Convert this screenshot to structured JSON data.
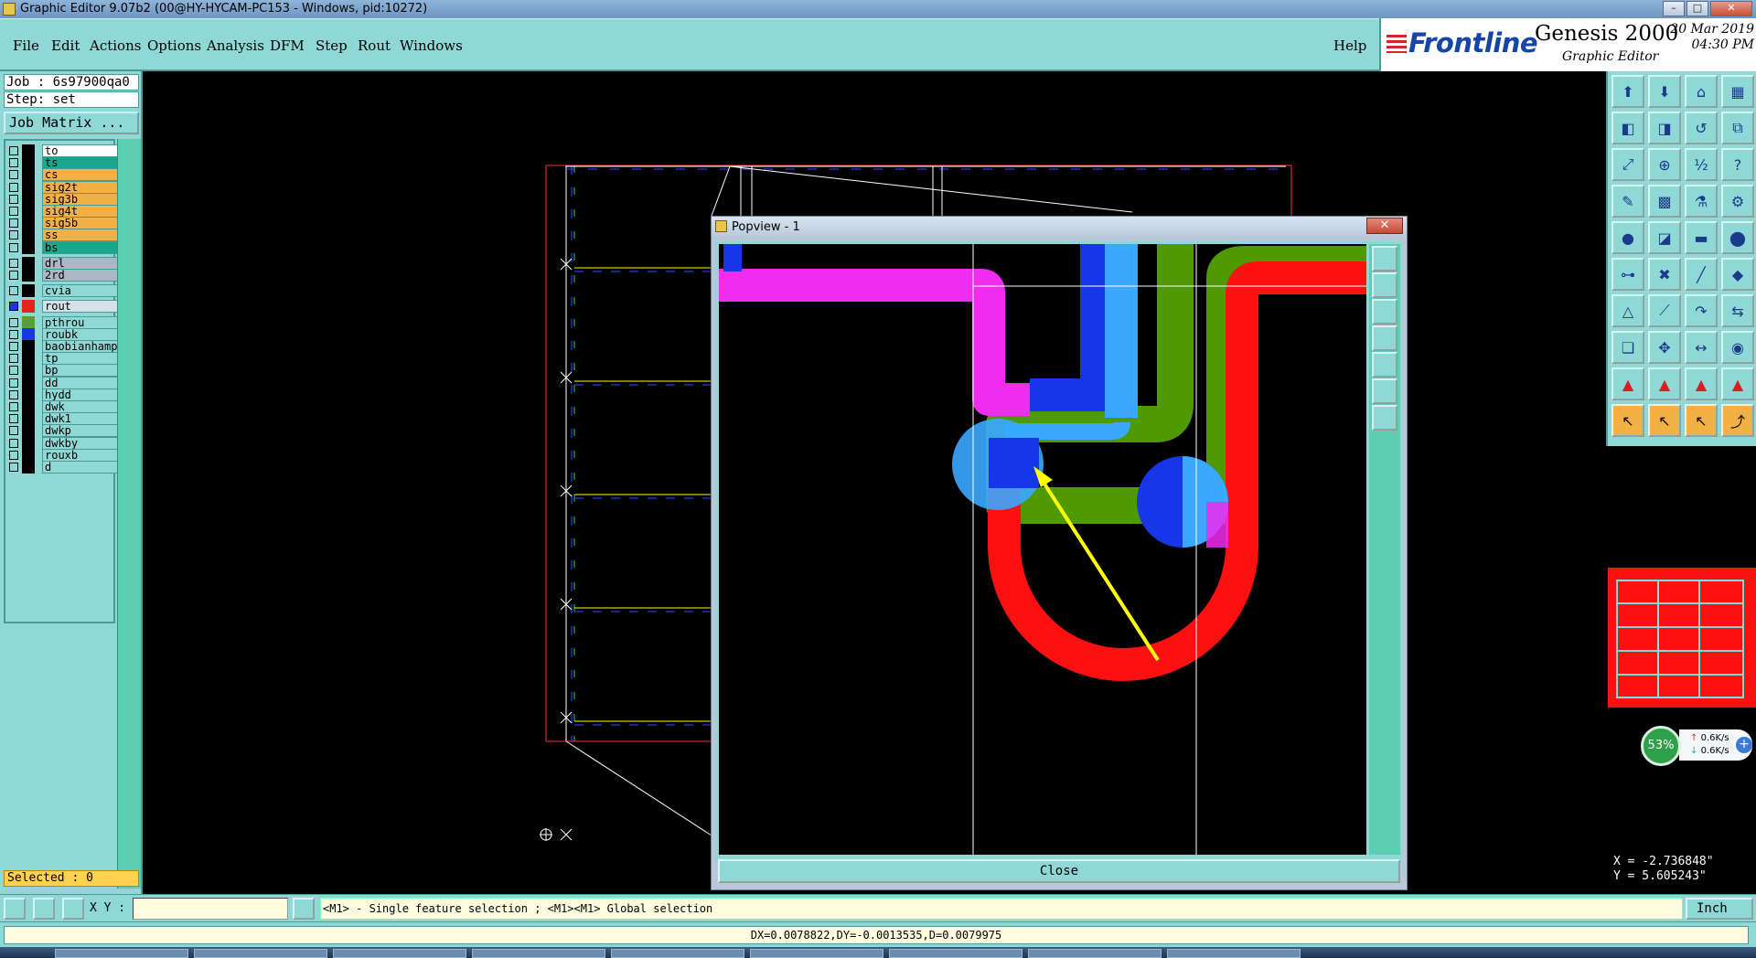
{
  "window": {
    "title": "Graphic Editor 9.07b2 (00@HY-HYCAM-PC153 - Windows, pid:10272)",
    "controls": [
      "–",
      "□",
      "✕"
    ]
  },
  "menu": [
    "File",
    "Edit",
    "Actions",
    "Options",
    "Analysis",
    "DFM",
    "Step",
    "Rout",
    "Windows"
  ],
  "menu_help": "Help",
  "brand": {
    "logo": "Frontline",
    "product": "Genesis 2000",
    "subtitle": "Graphic Editor",
    "date": "20 Mar 2019",
    "time": "04:30 PM"
  },
  "job": {
    "job_label": "Job : 6s97900qa0",
    "step_label": "Step: set",
    "matrix_button": "Job Matrix ..."
  },
  "layers": [
    {
      "name": "to",
      "color": "#ffffff",
      "swatch": "#000000"
    },
    {
      "name": "ts",
      "color": "#17a88c",
      "swatch": "#000000"
    },
    {
      "name": "cs",
      "color": "#f3b046",
      "swatch": "#000000"
    },
    {
      "name": "sig2t",
      "color": "#f3b046",
      "swatch": "#000000"
    },
    {
      "name": "sig3b",
      "color": "#f3b046",
      "swatch": "#000000"
    },
    {
      "name": "sig4t",
      "color": "#f3b046",
      "swatch": "#000000"
    },
    {
      "name": "sig5b",
      "color": "#f3b046",
      "swatch": "#000000"
    },
    {
      "name": "ss",
      "color": "#f3b046",
      "swatch": "#000000"
    },
    {
      "name": "bs",
      "color": "#17a88c",
      "swatch": "#000000"
    },
    {
      "name": "drl",
      "color": "#a9b8c4",
      "swatch": "#000000",
      "gap": true
    },
    {
      "name": "2rd",
      "color": "#a9b8c4",
      "swatch": "#000000"
    },
    {
      "name": "cvia",
      "color": "#8fd8d6",
      "swatch": "#000000",
      "gap": true
    },
    {
      "name": "rout",
      "color": "#d8e0e8",
      "swatch": "#e8201e",
      "gap": true,
      "active": true
    },
    {
      "name": "pthrou",
      "color": "#8fd8d6",
      "swatch": "#5aa02a",
      "gap": true
    },
    {
      "name": "roubk",
      "color": "#8fd8d6",
      "swatch": "#1736e8"
    },
    {
      "name": "baobianhampa",
      "color": "#8fd8d6",
      "swatch": "#000000"
    },
    {
      "name": "tp",
      "color": "#8fd8d6",
      "swatch": "#000000"
    },
    {
      "name": "bp",
      "color": "#8fd8d6",
      "swatch": "#000000"
    },
    {
      "name": "dd",
      "color": "#8fd8d6",
      "swatch": "#000000"
    },
    {
      "name": "hydd",
      "color": "#8fd8d6",
      "swatch": "#000000"
    },
    {
      "name": "dwk",
      "color": "#8fd8d6",
      "swatch": "#000000"
    },
    {
      "name": "dwk1",
      "color": "#8fd8d6",
      "swatch": "#000000"
    },
    {
      "name": "dwkp",
      "color": "#8fd8d6",
      "swatch": "#000000"
    },
    {
      "name": "dwkby",
      "color": "#8fd8d6",
      "swatch": "#000000"
    },
    {
      "name": "rouxb",
      "color": "#8fd8d6",
      "swatch": "#000000"
    },
    {
      "name": "d",
      "color": "#8fd8d6",
      "swatch": "#000000"
    }
  ],
  "selected_label": "Selected : 0",
  "popup": {
    "title": "Popview - 1",
    "close_x": "✕",
    "close_button": "Close"
  },
  "right_tools": [
    "step-open-icon",
    "step-save-icon",
    "home-icon",
    "window-split-icon",
    "layer-prev-icon",
    "layer-next-icon",
    "rotate-icon",
    "snap-icon",
    "zoom-fit-icon",
    "zoom-area-icon",
    "scale-icon",
    "help-icon",
    "measure-icon",
    "grid-icon",
    "filter-icon",
    "parameters-icon",
    "pad-add-icon",
    "polygon-icon",
    "ruler-icon",
    "circle-icon",
    "connect-icon",
    "delete-node-icon",
    "line-icon",
    "surface-icon",
    "arc-add-icon",
    "line-add-icon",
    "arc-edit-icon",
    "align-icon",
    "copy-icon",
    "move-icon",
    "distance-icon",
    "drill-icon",
    "triangle-red-icon",
    "triangle-a-icon",
    "triangle-b-icon",
    "triangle-c-icon",
    "select-arrow-icon",
    "select-single-icon",
    "select-pointer-icon",
    "route-icon"
  ],
  "coords": {
    "x": "X = -2.736848\"",
    "y": "Y = 5.605243\""
  },
  "netwidget": {
    "percent": "53%",
    "up": "0.6K/s",
    "down": "0.6K/s",
    "plus": "+"
  },
  "command": {
    "xy_label": "X Y :",
    "xy_value": "",
    "hint": "<M1> - Single feature selection ; <M1><M1> Global selection",
    "unit": "Inch"
  },
  "status": "DX=0.0078822,DY=-0.0013535,D=0.0079975",
  "colors": {
    "panel": "#8fd8d6",
    "accent": "#5ccfb3",
    "magenta": "#f02cf0",
    "blue": "#1736e8",
    "lightblue": "#3aa8ff",
    "green": "#4f9a02",
    "red": "#ff1010",
    "yellow": "#ffff00"
  }
}
